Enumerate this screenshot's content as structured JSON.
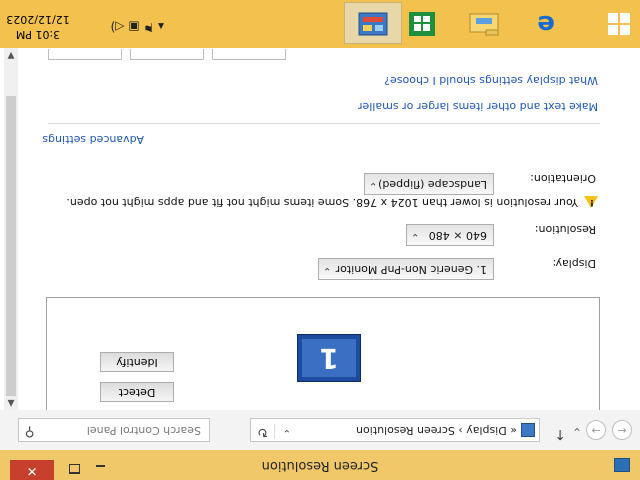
{
  "window": {
    "title": "Screen Resolution",
    "close_label": "✕"
  },
  "address_bar": {
    "crumbs": "«  Display  ›  Screen Resolution",
    "search_placeholder": "Search Control Panel"
  },
  "content": {
    "buttons": {
      "detect": "Detect",
      "identify": "Identify"
    },
    "monitor_number": "1",
    "display_label": "Display:",
    "display_value": "1. Generic Non-PnP Monitor",
    "resolution_label": "Resolution:",
    "resolution_value": "640 × 480",
    "warning_text": "Your resolution is lower than 1024 x 768. Some items might not fit and apps might not open.",
    "orientation_label": "Orientation:",
    "orientation_value": "Landscape (flipped)",
    "advanced_link": "Advanced settings",
    "link_text_size": "Make text and other items larger or smaller",
    "link_which": "What display settings should I choose?"
  },
  "taskbar": {
    "time": "3:01 PM",
    "date": "12/12/2023",
    "apps": [
      "Internet Explorer",
      "File Explorer",
      "Store",
      "Control Panel"
    ]
  },
  "icons": {
    "back": "arrow-left-icon",
    "forward": "arrow-right-icon",
    "up": "arrow-up-icon",
    "refresh": "refresh-icon",
    "search": "search-icon",
    "warning": "warning-icon",
    "cursor": "mouse-cursor"
  },
  "colors": {
    "taskbar": "#f2c14e",
    "titlebar": "#f0c86a",
    "close": "#c7402d",
    "link": "#1f56b8"
  }
}
